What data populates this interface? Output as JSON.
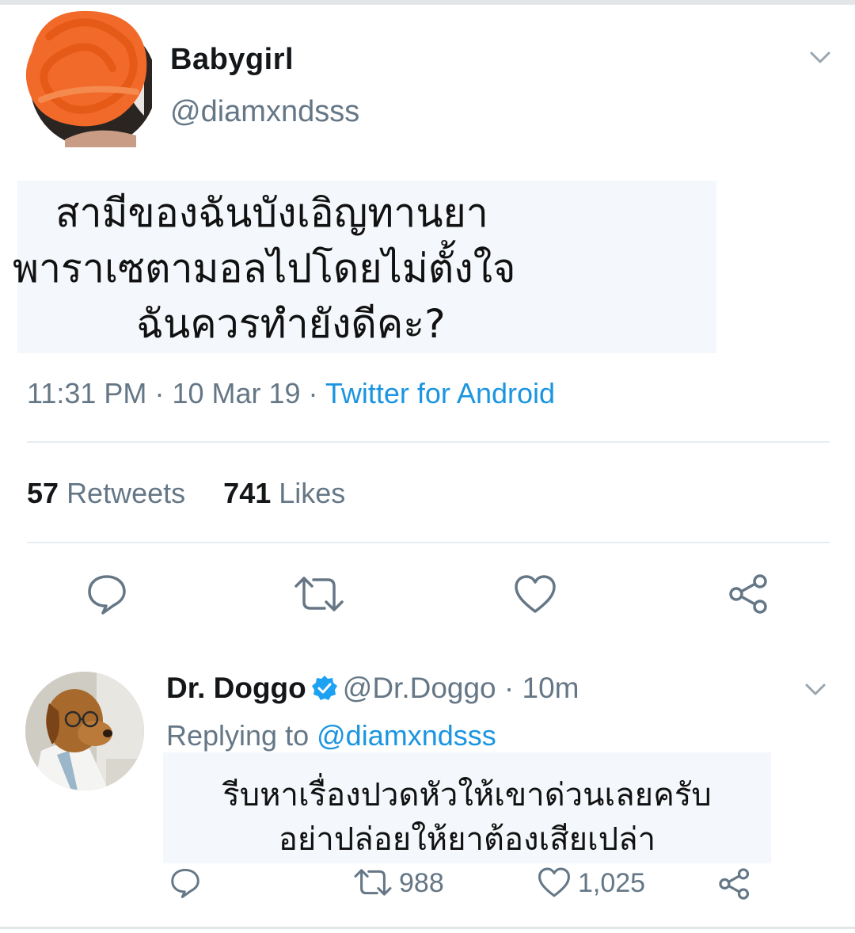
{
  "tweet": {
    "display_name": "Babygirl",
    "handle": "@diamxndsss",
    "text_lines": [
      "สามีของฉันบังเอิญทานยา",
      "พาราเซตามอลไปโดยไม่ตั้งใจ",
      "ฉันควรทำยังดีคะ?"
    ],
    "time": "11:31 PM",
    "date": "10 Mar 19",
    "source": "Twitter for Android",
    "retweets_count": "57",
    "retweets_label": "Retweets",
    "likes_count": "741",
    "likes_label": "Likes"
  },
  "reply": {
    "display_name": "Dr. Doggo",
    "handle": "@Dr.Doggo",
    "age": "10m",
    "replying_prefix": "Replying to",
    "replying_to": "@diamxndsss",
    "text_lines": [
      "รีบหาเรื่องปวดหัวให้เขาด่วนเลยครับ",
      "อย่าปล่อยให้ยาต้องเสียเปล่า"
    ],
    "retweet_count": "988",
    "like_count": "1,025"
  },
  "colors": {
    "link_blue": "#1b95e0",
    "gray_text": "#657786",
    "highlight_bg": "#f4f7fb",
    "scribble_orange": "#f26a2a"
  },
  "icons": [
    "chevron-down-icon",
    "reply-icon",
    "retweet-icon",
    "like-icon",
    "share-icon",
    "verified-badge-icon"
  ]
}
